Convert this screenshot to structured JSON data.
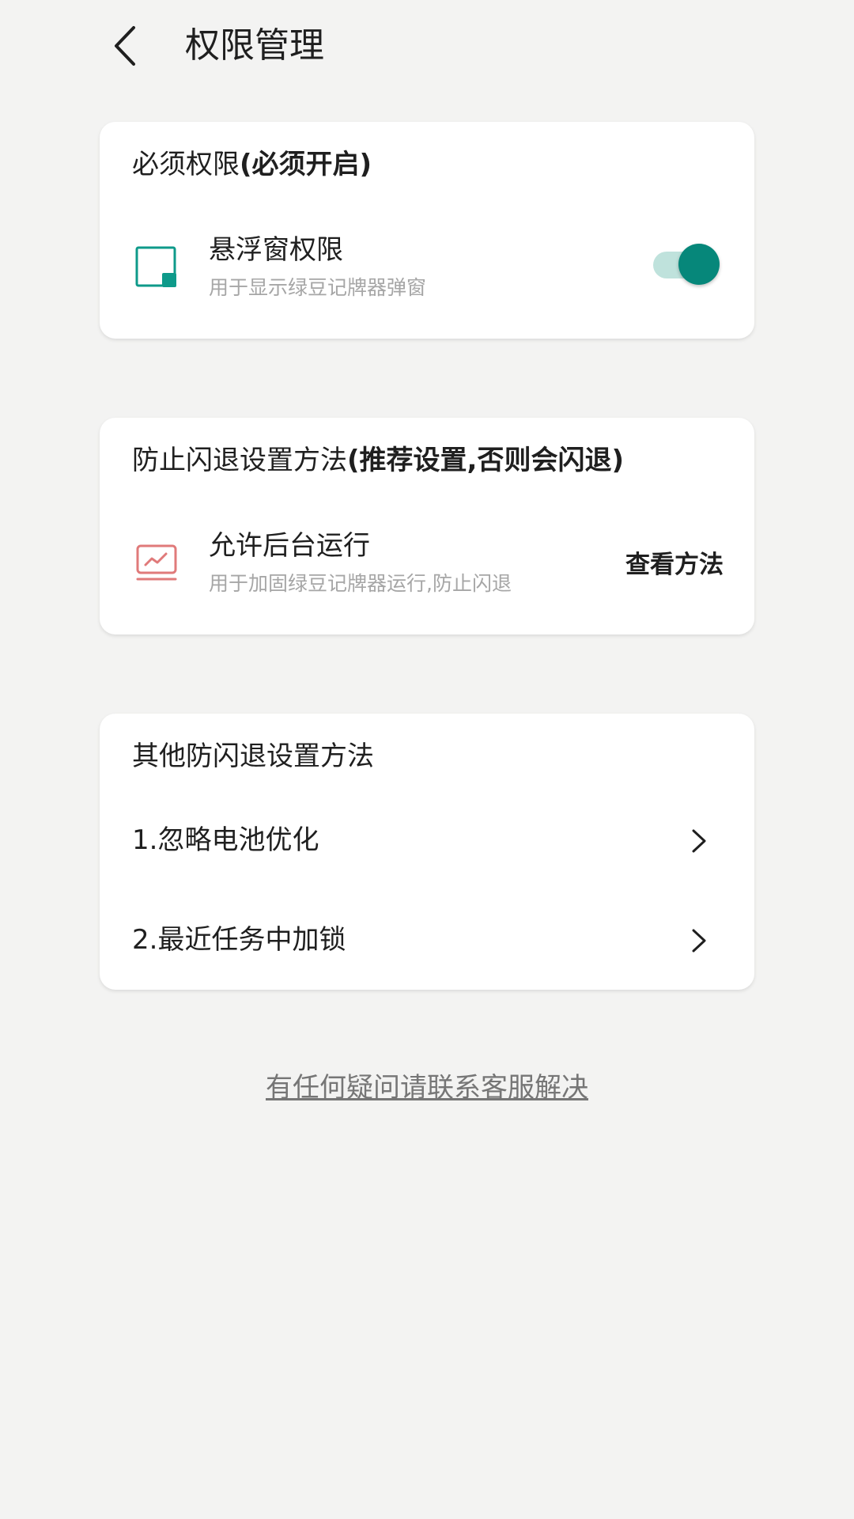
{
  "header": {
    "title": "权限管理",
    "back_icon": "chevron-left-icon"
  },
  "required_card": {
    "title_normal": "必须权限",
    "title_bold": "(必须开启)",
    "item": {
      "icon": "floating-window-icon",
      "title": "悬浮窗权限",
      "description": "用于显示绿豆记牌器弹窗",
      "toggle_on": true
    }
  },
  "prevent_card": {
    "title_normal": "防止闪退设置方法",
    "title_bold": "(推荐设置,否则会闪退)",
    "item": {
      "icon": "monitor-chart-icon",
      "title": "允许后台运行",
      "description": "用于加固绿豆记牌器运行,防止闪退",
      "action_label": "查看方法"
    }
  },
  "other_card": {
    "title": "其他防闪退设置方法",
    "items": [
      {
        "label": "1.忽略电池优化"
      },
      {
        "label": "2.最近任务中加锁"
      }
    ]
  },
  "footer": {
    "help_text": "有任何疑问请联系客服解决"
  },
  "colors": {
    "accent": "#06877a",
    "accent_light": "#bfe2dc",
    "warning_icon": "#e07a7a",
    "background": "#f3f3f2"
  }
}
